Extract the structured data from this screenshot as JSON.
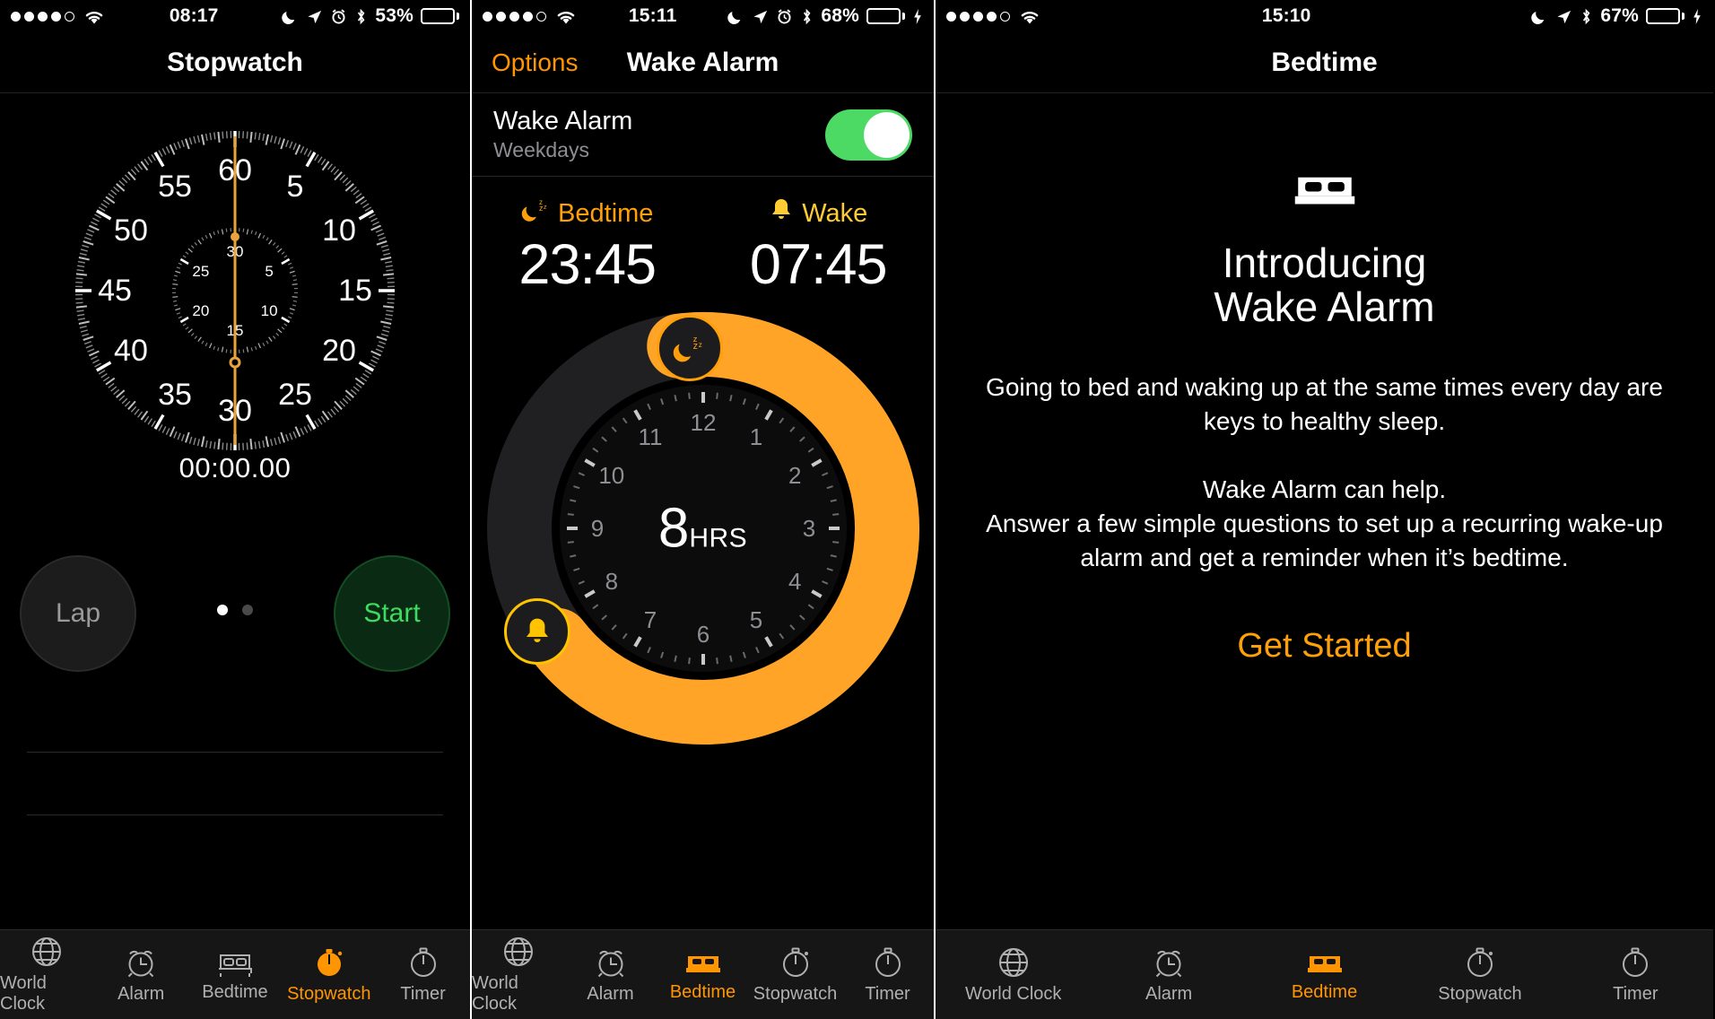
{
  "panels": {
    "stopwatch": {
      "status": {
        "time": "08:17",
        "battery_pct": "53%",
        "signal_dots": 4,
        "icons": [
          "moon-icon",
          "location-icon",
          "alarm-icon",
          "bluetooth-icon"
        ]
      },
      "nav_title": "Stopwatch",
      "elapsed": "00:00.00",
      "lap_label": "Lap",
      "start_label": "Start",
      "dial": {
        "outer_labels": [
          "60",
          "5",
          "10",
          "15",
          "20",
          "25",
          "30",
          "35",
          "40",
          "45",
          "50",
          "55"
        ],
        "inner_labels": [
          "30",
          "5",
          "10",
          "15",
          "20",
          "25"
        ]
      }
    },
    "wake_alarm": {
      "status": {
        "time": "15:11",
        "battery_pct": "68%",
        "signal_dots": 4,
        "icons": [
          "moon-icon",
          "location-icon",
          "alarm-icon",
          "bluetooth-icon",
          "charging-icon"
        ]
      },
      "nav_left": "Options",
      "nav_title": "Wake Alarm",
      "row": {
        "title": "Wake Alarm",
        "subtitle": "Weekdays",
        "toggle_on": true
      },
      "bedtime": {
        "label": "Bedtime",
        "time": "23:45",
        "icon": "moon-zzz-icon"
      },
      "wake": {
        "label": "Wake",
        "time": "07:45",
        "icon": "bell-icon"
      },
      "duration_value": "8",
      "duration_unit": "HRS",
      "clock_hours": [
        "12",
        "1",
        "2",
        "3",
        "4",
        "5",
        "6",
        "7",
        "8",
        "9",
        "10",
        "11"
      ]
    },
    "bedtime_intro": {
      "status": {
        "time": "15:10",
        "battery_pct": "67%",
        "signal_dots": 4,
        "icons": [
          "moon-icon",
          "location-icon",
          "bluetooth-icon",
          "charging-icon"
        ]
      },
      "nav_title": "Bedtime",
      "heading_line1": "Introducing",
      "heading_line2": "Wake Alarm",
      "body1": "Going to bed and waking up at the same times every day are keys to healthy sleep.",
      "body2": "Wake Alarm can help.\nAnswer a few simple questions to set up a recurring wake-up alarm and get a reminder when it’s bedtime.",
      "cta": "Get Started"
    }
  },
  "tabbar": {
    "items": [
      {
        "label": "World Clock",
        "icon": "globe-icon"
      },
      {
        "label": "Alarm",
        "icon": "alarm-clock-icon"
      },
      {
        "label": "Bedtime",
        "icon": "bed-icon"
      },
      {
        "label": "Stopwatch",
        "icon": "stopwatch-icon"
      },
      {
        "label": "Timer",
        "icon": "timer-icon"
      }
    ],
    "active_panel1": "Stopwatch",
    "active_panel2": "Bedtime",
    "active_panel3": "Bedtime"
  },
  "colors": {
    "accent_orange": "#ff9500",
    "arc_orange": "#ffa426",
    "arc_yellow": "#ffc400",
    "toggle_green": "#4cd964",
    "start_green": "#3ddc5e",
    "background": "#000000"
  }
}
